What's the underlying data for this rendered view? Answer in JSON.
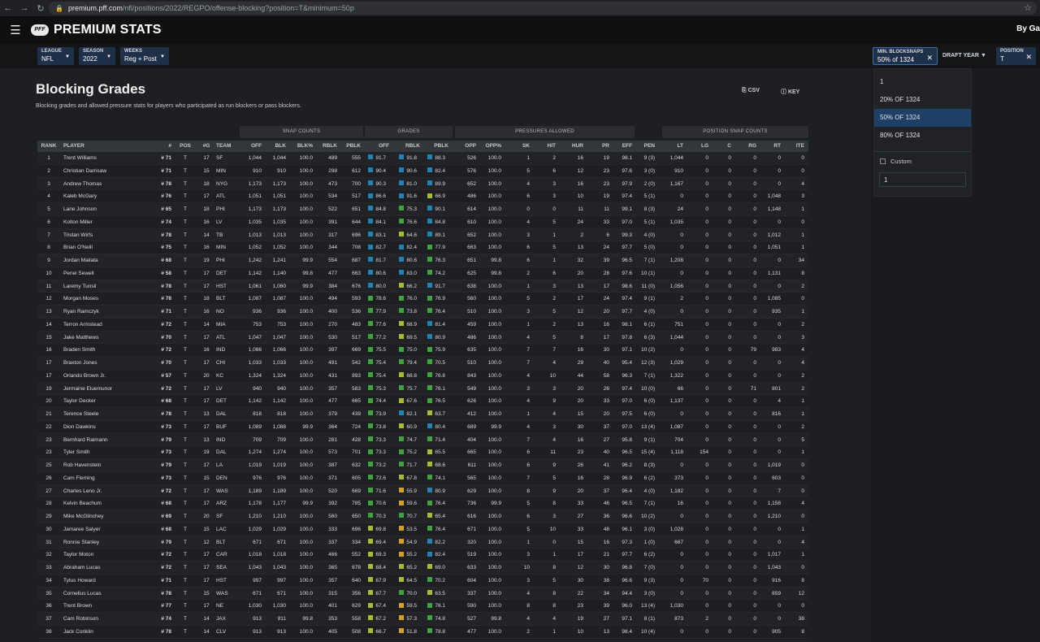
{
  "browser": {
    "url_host": "premium.pff.com",
    "url_path": "/nfl/positions/2022/REGPO/offense-blocking?position=T&minimum=50p"
  },
  "app": {
    "brand": "PREMIUM STATS",
    "logo": "PFF",
    "by_game": "By Ga"
  },
  "filters": {
    "league": {
      "label": "LEAGUE",
      "value": "NFL"
    },
    "season": {
      "label": "SEASON",
      "value": "2022"
    },
    "weeks": {
      "label": "WEEKS",
      "value": "Reg + Post"
    },
    "min_snaps": {
      "label": "MIN. BLOCKSNAPS",
      "value": "50% of 1324"
    },
    "draft_year": {
      "label": "DRAFT YEAR"
    },
    "position": {
      "label": "POSITION",
      "value": "T"
    }
  },
  "dropdown": {
    "options": [
      "1",
      "20% OF 1324",
      "50% OF 1324",
      "80% OF 1324"
    ],
    "selected_index": 2,
    "custom_label": "Custom",
    "custom_value": "1"
  },
  "page": {
    "title": "Blocking Grades",
    "subtitle": "Blocking grades and allowed pressure stats for players who participated as run blockers or pass blockers.",
    "csv": "CSV",
    "key": "KEY"
  },
  "groups": {
    "snap": "SNAP COUNTS",
    "grades": "GRADES",
    "pressures": "PRESSURES ALLOWED",
    "position_snaps": "POSITION SNAP COUNTS"
  },
  "columns": [
    "RANK",
    "PLAYER",
    "#",
    "POS",
    "#G",
    "TEAM",
    "OFF",
    "BLK",
    "BLK%",
    "RBLK",
    "PBLK",
    "OFF",
    "RBLK",
    "PBLK",
    "OPP",
    "OPP%",
    "SK",
    "HIT",
    "HUR",
    "PR",
    "EFF",
    "PEN",
    "LT",
    "LG",
    "C",
    "RG",
    "RT",
    "ITE"
  ],
  "grade_colors": {
    "elite": "#1f83b3",
    "high": "#3fa33f",
    "mid": "#a7bd2b",
    "low": "#d6a21e"
  },
  "rows": [
    [
      "1",
      "Trent Williams",
      "# 71",
      "T",
      "17",
      "SF",
      "1,044",
      "1,044",
      "100.0",
      "489",
      "555",
      "91.7",
      "91.8",
      "88.3",
      "526",
      "100.0",
      "1",
      "2",
      "16",
      "19",
      "98.1",
      "9 (3)",
      "1,044",
      "0",
      "0",
      "0",
      "0",
      "0"
    ],
    [
      "2",
      "Christian Darrisaw",
      "# 71",
      "T",
      "15",
      "MIN",
      "910",
      "910",
      "100.0",
      "298",
      "612",
      "90.4",
      "90.6",
      "82.4",
      "576",
      "100.0",
      "5",
      "6",
      "12",
      "23",
      "97.6",
      "3 (0)",
      "910",
      "0",
      "0",
      "0",
      "0",
      "0"
    ],
    [
      "3",
      "Andrew Thomas",
      "# 78",
      "T",
      "18",
      "NYG",
      "1,173",
      "1,173",
      "100.0",
      "473",
      "700",
      "90.3",
      "81.0",
      "89.9",
      "652",
      "100.0",
      "4",
      "3",
      "16",
      "23",
      "97.9",
      "2 (0)",
      "1,167",
      "0",
      "0",
      "0",
      "0",
      "4"
    ],
    [
      "4",
      "Kaleb McGary",
      "# 76",
      "T",
      "17",
      "ATL",
      "1,051",
      "1,051",
      "100.0",
      "534",
      "517",
      "86.6",
      "91.6",
      "66.9",
      "486",
      "100.0",
      "6",
      "3",
      "10",
      "19",
      "97.4",
      "5 (1)",
      "0",
      "0",
      "0",
      "0",
      "1,048",
      "3"
    ],
    [
      "5",
      "Lane Johnson",
      "# 65",
      "T",
      "18",
      "PHI",
      "1,173",
      "1,173",
      "100.0",
      "522",
      "651",
      "84.8",
      "75.3",
      "90.1",
      "614",
      "100.0",
      "0",
      "0",
      "11",
      "11",
      "99.1",
      "8 (3)",
      "24",
      "0",
      "0",
      "0",
      "1,148",
      "1"
    ],
    [
      "6",
      "Kolton Miller",
      "# 74",
      "T",
      "16",
      "LV",
      "1,035",
      "1,035",
      "100.0",
      "391",
      "644",
      "84.1",
      "76.6",
      "84.8",
      "610",
      "100.0",
      "4",
      "5",
      "24",
      "33",
      "97.0",
      "5 (1)",
      "1,035",
      "0",
      "0",
      "0",
      "0",
      "0"
    ],
    [
      "7",
      "Tristan Wirfs",
      "# 78",
      "T",
      "14",
      "TB",
      "1,013",
      "1,013",
      "100.0",
      "317",
      "696",
      "83.1",
      "64.6",
      "89.1",
      "652",
      "100.0",
      "3",
      "1",
      "2",
      "6",
      "99.3",
      "4 (0)",
      "0",
      "0",
      "0",
      "0",
      "1,012",
      "1"
    ],
    [
      "8",
      "Brian O'Neill",
      "# 75",
      "T",
      "16",
      "MIN",
      "1,052",
      "1,052",
      "100.0",
      "344",
      "708",
      "82.7",
      "82.4",
      "77.9",
      "663",
      "100.0",
      "6",
      "5",
      "13",
      "24",
      "97.7",
      "5 (0)",
      "0",
      "0",
      "0",
      "0",
      "1,051",
      "1"
    ],
    [
      "9",
      "Jordan Mailata",
      "# 68",
      "T",
      "19",
      "PHI",
      "1,242",
      "1,241",
      "99.9",
      "554",
      "687",
      "81.7",
      "80.6",
      "76.3",
      "651",
      "99.8",
      "6",
      "1",
      "32",
      "39",
      "96.5",
      "7 (1)",
      "1,208",
      "0",
      "0",
      "0",
      "0",
      "34"
    ],
    [
      "10",
      "Penei Sewell",
      "# 58",
      "T",
      "17",
      "DET",
      "1,142",
      "1,140",
      "99.8",
      "477",
      "663",
      "80.6",
      "83.0",
      "74.2",
      "625",
      "99.8",
      "2",
      "6",
      "20",
      "28",
      "97.6",
      "10 (1)",
      "0",
      "0",
      "0",
      "0",
      "1,131",
      "8"
    ],
    [
      "11",
      "Laremy Tunsil",
      "# 78",
      "T",
      "17",
      "HST",
      "1,061",
      "1,060",
      "99.9",
      "384",
      "676",
      "80.0",
      "66.2",
      "91.7",
      "638",
      "100.0",
      "1",
      "3",
      "13",
      "17",
      "98.6",
      "11 (0)",
      "1,056",
      "0",
      "0",
      "0",
      "0",
      "2"
    ],
    [
      "12",
      "Morgan Moses",
      "# 78",
      "T",
      "18",
      "BLT",
      "1,087",
      "1,087",
      "100.0",
      "494",
      "593",
      "78.6",
      "76.0",
      "76.9",
      "560",
      "100.0",
      "5",
      "2",
      "17",
      "24",
      "97.4",
      "9 (1)",
      "2",
      "0",
      "0",
      "0",
      "1,085",
      "0"
    ],
    [
      "13",
      "Ryan Ramczyk",
      "# 71",
      "T",
      "16",
      "NO",
      "936",
      "936",
      "100.0",
      "400",
      "536",
      "77.9",
      "73.8",
      "76.4",
      "510",
      "100.0",
      "3",
      "5",
      "12",
      "20",
      "97.7",
      "4 (0)",
      "0",
      "0",
      "0",
      "0",
      "935",
      "1"
    ],
    [
      "14",
      "Terron Armstead",
      "# 72",
      "T",
      "14",
      "MIA",
      "753",
      "753",
      "100.0",
      "270",
      "483",
      "77.6",
      "68.9",
      "81.4",
      "459",
      "100.0",
      "1",
      "2",
      "13",
      "16",
      "98.1",
      "6 (1)",
      "751",
      "0",
      "0",
      "0",
      "0",
      "2"
    ],
    [
      "15",
      "Jake Matthews",
      "# 70",
      "T",
      "17",
      "ATL",
      "1,047",
      "1,047",
      "100.0",
      "530",
      "517",
      "77.2",
      "69.5",
      "80.9",
      "486",
      "100.0",
      "4",
      "5",
      "8",
      "17",
      "97.8",
      "6 (3)",
      "1,044",
      "0",
      "0",
      "0",
      "0",
      "3"
    ],
    [
      "16",
      "Braden Smith",
      "# 72",
      "T",
      "16",
      "IND",
      "1,066",
      "1,066",
      "100.0",
      "397",
      "669",
      "75.5",
      "75.0",
      "75.9",
      "635",
      "100.0",
      "7",
      "7",
      "16",
      "30",
      "97.1",
      "10 (2)",
      "0",
      "0",
      "0",
      "79",
      "983",
      "4"
    ],
    [
      "17",
      "Braxton Jones",
      "# 70",
      "T",
      "17",
      "CHI",
      "1,033",
      "1,033",
      "100.0",
      "491",
      "542",
      "75.4",
      "79.4",
      "70.5",
      "510",
      "100.0",
      "7",
      "4",
      "29",
      "40",
      "95.4",
      "12 (3)",
      "1,029",
      "0",
      "0",
      "0",
      "0",
      "4"
    ],
    [
      "17",
      "Orlando Brown Jr.",
      "# 57",
      "T",
      "20",
      "KC",
      "1,324",
      "1,324",
      "100.0",
      "431",
      "893",
      "75.4",
      "68.8",
      "76.8",
      "843",
      "100.0",
      "4",
      "10",
      "44",
      "58",
      "96.3",
      "7 (1)",
      "1,322",
      "0",
      "0",
      "0",
      "0",
      "2"
    ],
    [
      "19",
      "Jermaine Eluemunor",
      "# 72",
      "T",
      "17",
      "LV",
      "940",
      "940",
      "100.0",
      "357",
      "583",
      "75.3",
      "75.7",
      "76.1",
      "549",
      "100.0",
      "3",
      "3",
      "20",
      "26",
      "97.4",
      "10 (0)",
      "66",
      "0",
      "0",
      "71",
      "801",
      "2"
    ],
    [
      "20",
      "Taylor Decker",
      "# 68",
      "T",
      "17",
      "DET",
      "1,142",
      "1,142",
      "100.0",
      "477",
      "665",
      "74.4",
      "67.6",
      "76.5",
      "626",
      "100.0",
      "4",
      "9",
      "20",
      "33",
      "97.0",
      "6 (0)",
      "1,137",
      "0",
      "0",
      "0",
      "4",
      "1"
    ],
    [
      "21",
      "Terence Steele",
      "# 78",
      "T",
      "13",
      "DAL",
      "818",
      "818",
      "100.0",
      "379",
      "439",
      "73.9",
      "82.1",
      "63.7",
      "412",
      "100.0",
      "1",
      "4",
      "15",
      "20",
      "97.5",
      "6 (0)",
      "0",
      "0",
      "0",
      "0",
      "816",
      "1"
    ],
    [
      "22",
      "Dion Dawkins",
      "# 73",
      "T",
      "17",
      "BUF",
      "1,089",
      "1,088",
      "99.9",
      "364",
      "724",
      "73.8",
      "60.9",
      "80.4",
      "689",
      "99.9",
      "4",
      "3",
      "30",
      "37",
      "97.0",
      "13 (4)",
      "1,087",
      "0",
      "0",
      "0",
      "0",
      "2"
    ],
    [
      "23",
      "Bernhard Raimann",
      "# 79",
      "T",
      "13",
      "IND",
      "709",
      "709",
      "100.0",
      "281",
      "428",
      "73.3",
      "74.7",
      "71.4",
      "404",
      "100.0",
      "7",
      "4",
      "16",
      "27",
      "95.8",
      "9 (1)",
      "704",
      "0",
      "0",
      "0",
      "0",
      "5"
    ],
    [
      "23",
      "Tyler Smith",
      "# 73",
      "T",
      "19",
      "DAL",
      "1,274",
      "1,274",
      "100.0",
      "573",
      "701",
      "73.3",
      "75.2",
      "65.5",
      "665",
      "100.0",
      "6",
      "11",
      "23",
      "40",
      "96.5",
      "15 (4)",
      "1,118",
      "154",
      "0",
      "0",
      "0",
      "1"
    ],
    [
      "25",
      "Rob Havenstein",
      "# 79",
      "T",
      "17",
      "LA",
      "1,019",
      "1,019",
      "100.0",
      "387",
      "632",
      "73.2",
      "71.7",
      "68.6",
      "611",
      "100.0",
      "6",
      "9",
      "26",
      "41",
      "96.2",
      "8 (3)",
      "0",
      "0",
      "0",
      "0",
      "1,019",
      "0"
    ],
    [
      "26",
      "Cam Fleming",
      "# 73",
      "T",
      "15",
      "DEN",
      "976",
      "976",
      "100.0",
      "371",
      "605",
      "72.6",
      "67.8",
      "74.1",
      "565",
      "100.0",
      "7",
      "5",
      "16",
      "28",
      "96.9",
      "6 (2)",
      "373",
      "0",
      "0",
      "0",
      "603",
      "0"
    ],
    [
      "27",
      "Charles Leno Jr.",
      "# 72",
      "T",
      "17",
      "WAS",
      "1,189",
      "1,189",
      "100.0",
      "520",
      "669",
      "71.6",
      "55.9",
      "80.9",
      "629",
      "100.0",
      "8",
      "9",
      "20",
      "37",
      "96.4",
      "4 (0)",
      "1,182",
      "0",
      "0",
      "0",
      "7",
      "0"
    ],
    [
      "28",
      "Kelvin Beachum",
      "# 68",
      "T",
      "17",
      "ARZ",
      "1,178",
      "1,177",
      "99.9",
      "392",
      "785",
      "70.6",
      "59.6",
      "76.4",
      "736",
      "99.9",
      "5",
      "8",
      "33",
      "46",
      "96.5",
      "7 (1)",
      "16",
      "0",
      "0",
      "0",
      "1,158",
      "4"
    ],
    [
      "29",
      "Mike McGlinchey",
      "# 69",
      "T",
      "20",
      "SF",
      "1,210",
      "1,210",
      "100.0",
      "560",
      "650",
      "70.3",
      "70.7",
      "65.4",
      "616",
      "100.0",
      "6",
      "3",
      "27",
      "36",
      "96.6",
      "10 (2)",
      "0",
      "0",
      "0",
      "0",
      "1,210",
      "0"
    ],
    [
      "30",
      "Jamaree Salyer",
      "# 68",
      "T",
      "15",
      "LAC",
      "1,029",
      "1,029",
      "100.0",
      "333",
      "696",
      "69.8",
      "53.5",
      "76.4",
      "671",
      "100.0",
      "5",
      "10",
      "33",
      "48",
      "96.1",
      "3 (0)",
      "1,028",
      "0",
      "0",
      "0",
      "0",
      "1"
    ],
    [
      "31",
      "Ronnie Stanley",
      "# 79",
      "T",
      "12",
      "BLT",
      "671",
      "671",
      "100.0",
      "337",
      "334",
      "69.4",
      "54.9",
      "82.2",
      "320",
      "100.0",
      "1",
      "0",
      "15",
      "16",
      "97.3",
      "1 (0)",
      "667",
      "0",
      "0",
      "0",
      "0",
      "4"
    ],
    [
      "32",
      "Taylor Moton",
      "# 72",
      "T",
      "17",
      "CAR",
      "1,018",
      "1,018",
      "100.0",
      "466",
      "552",
      "69.3",
      "55.2",
      "82.4",
      "519",
      "100.0",
      "3",
      "1",
      "17",
      "21",
      "97.7",
      "6 (2)",
      "0",
      "0",
      "0",
      "0",
      "1,017",
      "1"
    ],
    [
      "33",
      "Abraham Lucas",
      "# 72",
      "T",
      "17",
      "SEA",
      "1,043",
      "1,043",
      "100.0",
      "365",
      "678",
      "68.4",
      "65.2",
      "69.0",
      "633",
      "100.0",
      "10",
      "8",
      "12",
      "30",
      "96.8",
      "7 (0)",
      "0",
      "0",
      "0",
      "0",
      "1,043",
      "0"
    ],
    [
      "34",
      "Tytus Howard",
      "# 71",
      "T",
      "17",
      "HST",
      "997",
      "997",
      "100.0",
      "357",
      "640",
      "67.9",
      "64.5",
      "70.2",
      "604",
      "100.0",
      "3",
      "5",
      "30",
      "38",
      "96.6",
      "9 (3)",
      "0",
      "70",
      "0",
      "0",
      "916",
      "8"
    ],
    [
      "35",
      "Cornelius Lucas",
      "# 78",
      "T",
      "15",
      "WAS",
      "671",
      "671",
      "100.0",
      "315",
      "356",
      "67.7",
      "70.0",
      "63.5",
      "337",
      "100.0",
      "4",
      "8",
      "22",
      "34",
      "94.4",
      "3 (0)",
      "0",
      "0",
      "0",
      "0",
      "659",
      "12"
    ],
    [
      "36",
      "Trent Brown",
      "# 77",
      "T",
      "17",
      "NE",
      "1,030",
      "1,030",
      "100.0",
      "401",
      "629",
      "67.4",
      "59.5",
      "76.1",
      "590",
      "100.0",
      "8",
      "8",
      "23",
      "39",
      "96.0",
      "13 (4)",
      "1,030",
      "0",
      "0",
      "0",
      "0",
      "0"
    ],
    [
      "37",
      "Cam Robinson",
      "# 74",
      "T",
      "14",
      "JAX",
      "913",
      "911",
      "99.8",
      "353",
      "558",
      "67.2",
      "57.3",
      "74.8",
      "527",
      "99.8",
      "4",
      "4",
      "19",
      "27",
      "97.1",
      "8 (1)",
      "873",
      "2",
      "0",
      "0",
      "0",
      "38"
    ],
    [
      "38",
      "Jack Conklin",
      "# 78",
      "T",
      "14",
      "CLV",
      "913",
      "913",
      "100.0",
      "405",
      "508",
      "66.7",
      "51.8",
      "78.8",
      "477",
      "100.0",
      "2",
      "1",
      "10",
      "13",
      "98.4",
      "10 (4)",
      "0",
      "0",
      "0",
      "0",
      "905",
      "8"
    ]
  ]
}
